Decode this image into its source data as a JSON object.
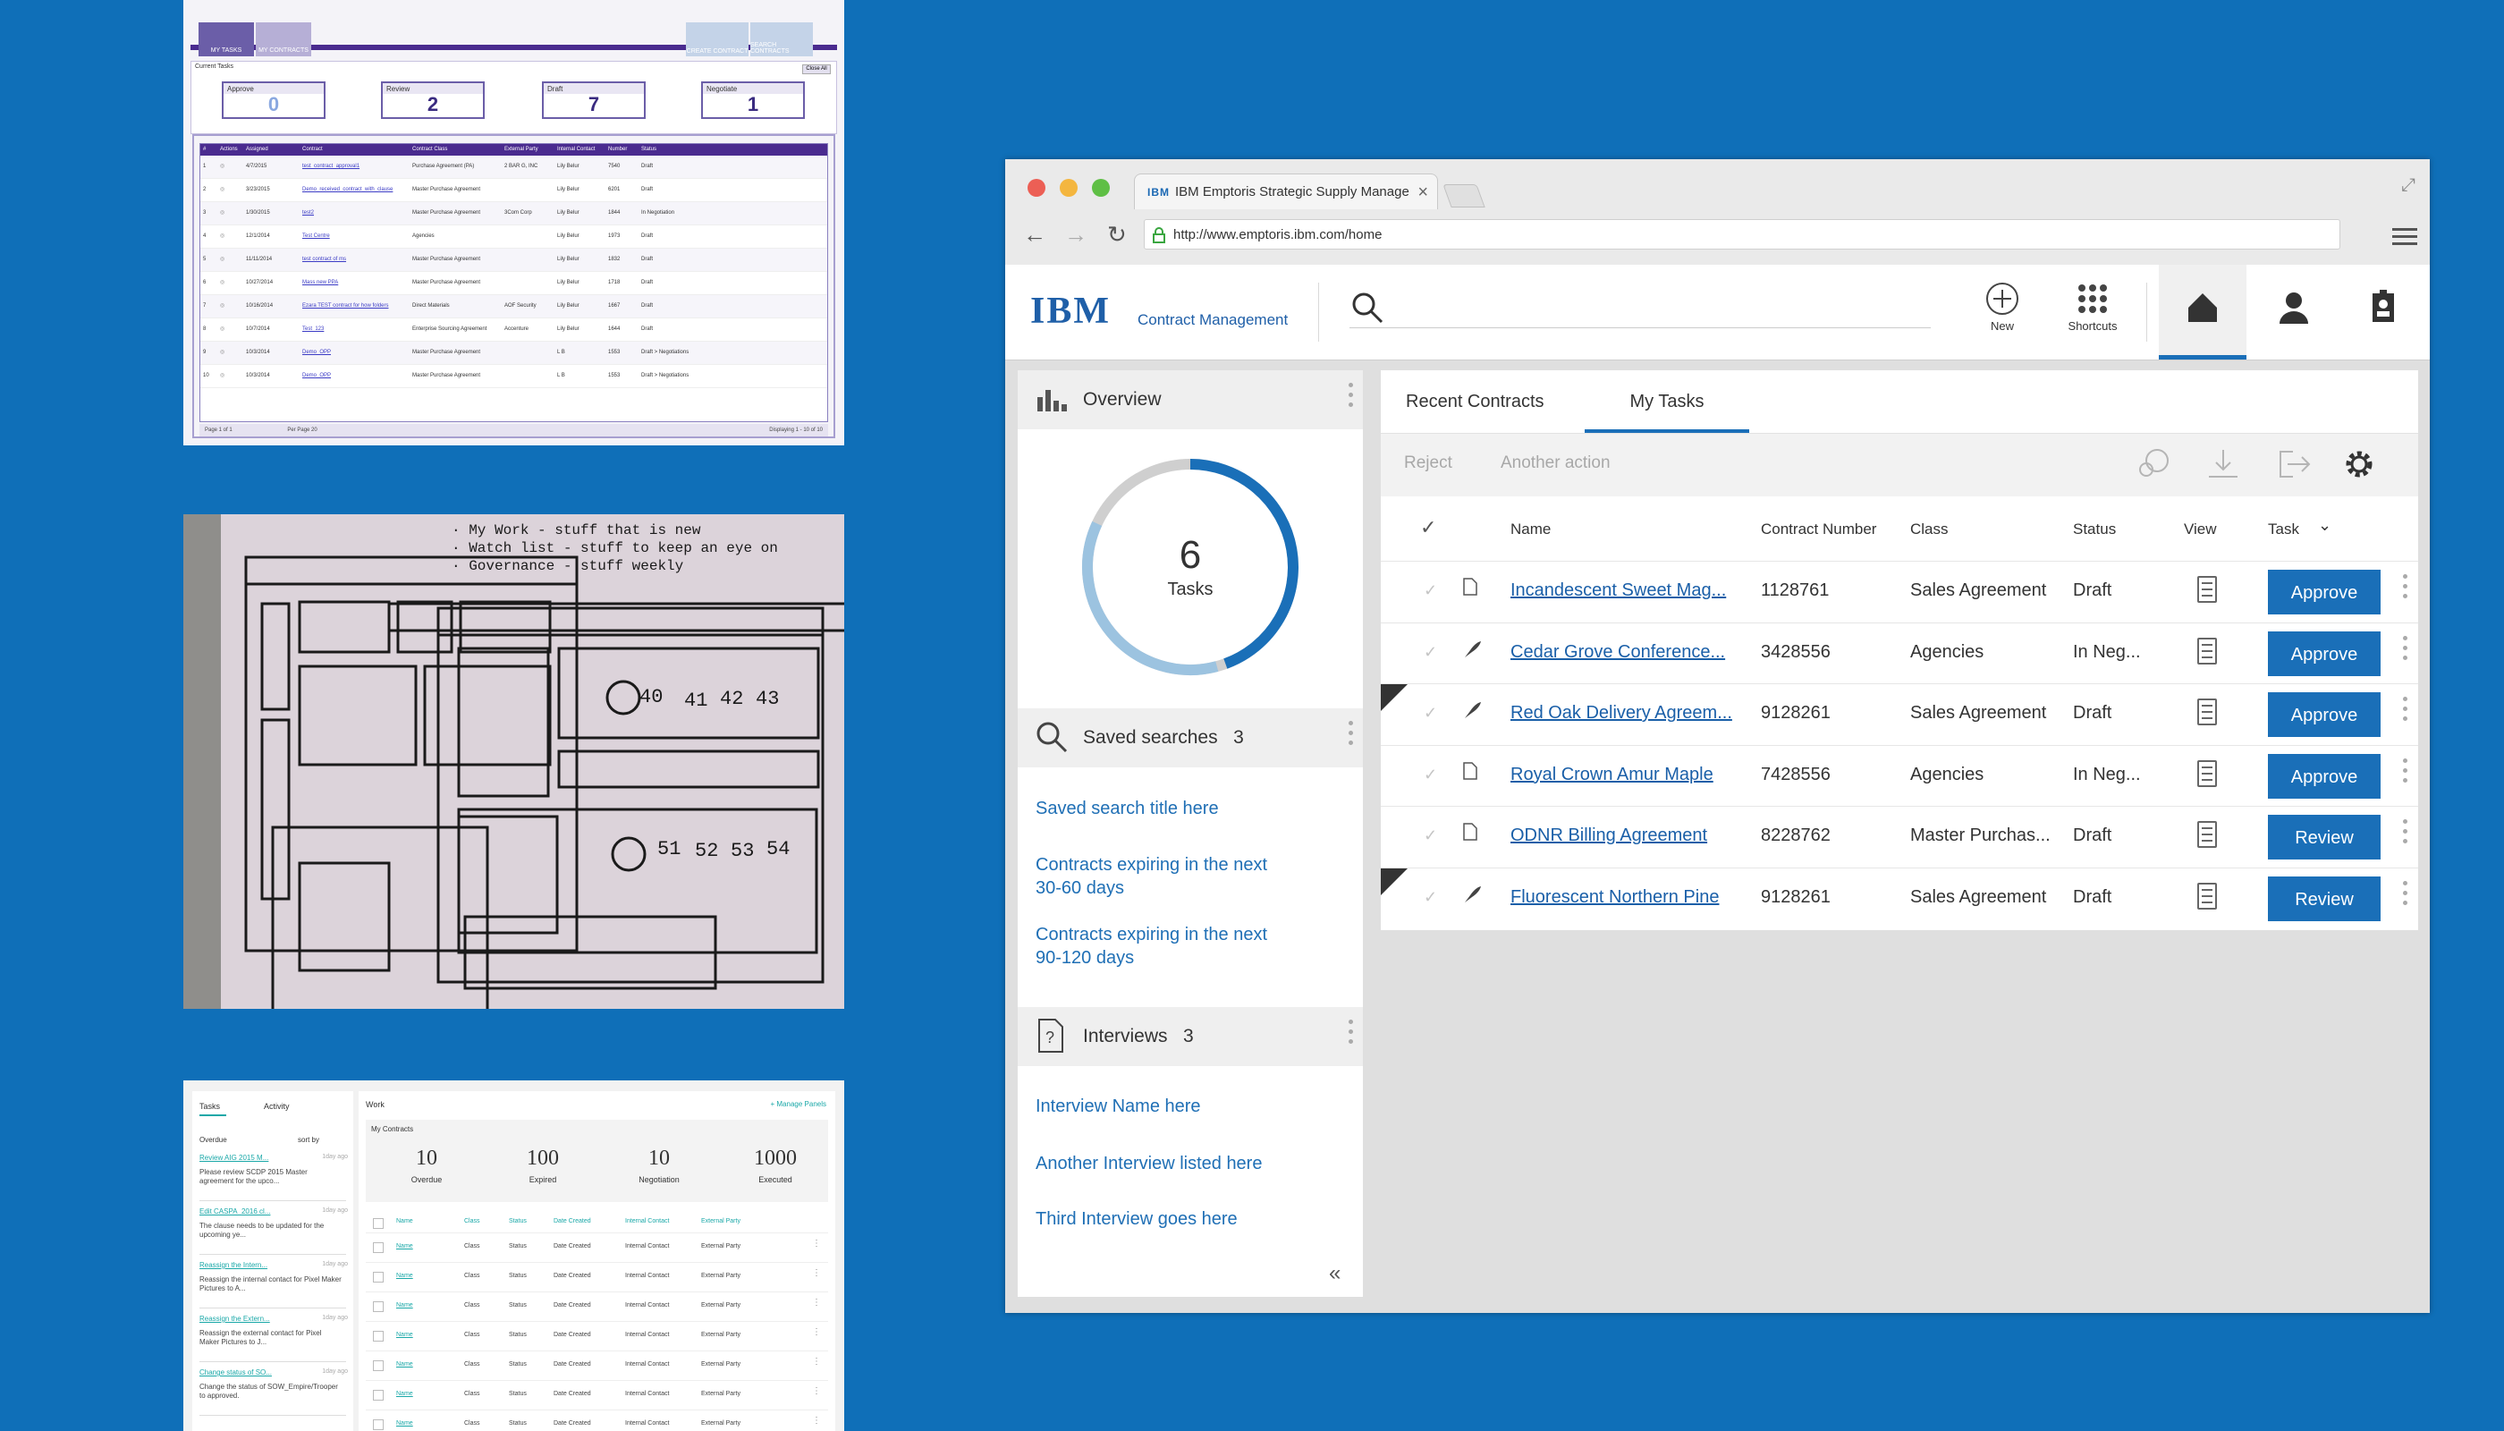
{
  "thumb_legacy": {
    "tabs": [
      "MY TASKS",
      "MY CONTRACTS"
    ],
    "actions": [
      "CREATE CONTRACT",
      "SEARCH CONTRACTS"
    ],
    "current_tasks_label": "Current Tasks",
    "close_label": "Close All",
    "boxes": [
      {
        "label": "Approve",
        "value": "0"
      },
      {
        "label": "Review",
        "value": "2"
      },
      {
        "label": "Draft",
        "value": "7"
      },
      {
        "label": "Negotiate",
        "value": "1"
      }
    ],
    "table_headers": [
      "#",
      "Actions",
      "Assigned",
      "Contract",
      "Contract Class",
      "External Party",
      "Internal Contact",
      "Number",
      "Status"
    ],
    "rows": [
      [
        "1",
        "4/7/2015",
        "test_contract_approval1",
        "Purchase Agreement (PA)",
        "2 BAR G, INC",
        "Lily Belur",
        "7540",
        "Draft"
      ],
      [
        "2",
        "3/23/2015",
        "Demo_received_contract_with_clause",
        "Master Purchase Agreement",
        "",
        "Lily Belur",
        "6201",
        "Draft"
      ],
      [
        "3",
        "1/30/2015",
        "test2",
        "Master Purchase Agreement",
        "3Com Corp",
        "Lily Belur",
        "1844",
        "In Negotiation"
      ],
      [
        "4",
        "12/1/2014",
        "Test Centre",
        "Agencies",
        "",
        "Lily Belur",
        "1973",
        "Draft"
      ],
      [
        "5",
        "11/11/2014",
        "test contract of ms",
        "Master Purchase Agreement",
        "",
        "Lily Belur",
        "1832",
        "Draft"
      ],
      [
        "6",
        "10/27/2014",
        "Mass new PPA",
        "Master Purchase Agreement",
        "",
        "Lily Belur",
        "1718",
        "Draft"
      ],
      [
        "7",
        "10/16/2014",
        "Ezara TEST contract for how folders",
        "Direct Materials",
        "AOF Security",
        "Lily Belur",
        "1667",
        "Draft"
      ],
      [
        "8",
        "10/7/2014",
        "Test_123",
        "Enterprise Sourcing Agreement",
        "Accenture",
        "Lily Belur",
        "1644",
        "Draft"
      ],
      [
        "9",
        "10/3/2014",
        "Demo_OPP",
        "Master Purchase Agreement",
        "",
        "L B",
        "1553",
        "Draft > Negotiations"
      ],
      [
        "10",
        "10/3/2014",
        "Demo_OPP",
        "Master Purchase Agreement",
        "",
        "L B",
        "1553",
        "Draft > Negotiations"
      ]
    ],
    "footer_left": "Page 1 of 1",
    "footer_per_page": "Per Page 20",
    "footer_right": "Displaying 1 - 10 of 10"
  },
  "thumb_panels": {
    "tabs": [
      "Tasks",
      "Activity"
    ],
    "overdue_label": "Overdue",
    "sort_label": "sort by",
    "tasks": [
      {
        "link": "Review AIG 2015 M...",
        "text": "Please review SCDP 2015 Master agreement for the upco...",
        "age": "1day ago"
      },
      {
        "link": "Edit CASPA_2016 cl...",
        "text": "The clause needs to be updated for the upcoming ye...",
        "age": "1day ago"
      },
      {
        "link": "Reassign the Intern...",
        "text": "Reassign the internal contact for Pixel Maker Pictures to A...",
        "age": "1day ago"
      },
      {
        "link": "Reassign the Extern...",
        "text": "Reassign the external contact for Pixel Maker Pictures to J...",
        "age": "1day ago"
      },
      {
        "link": "Change status of SO...",
        "text": "Change the status of SOW_Empire/Trooper to approved.",
        "age": "1day ago"
      }
    ],
    "work_label": "Work",
    "manage_label": "+ Manage Panels",
    "my_contracts_label": "My Contracts",
    "stats": [
      {
        "value": "10",
        "label": "Overdue"
      },
      {
        "value": "100",
        "label": "Expired"
      },
      {
        "value": "10",
        "label": "Negotiation"
      },
      {
        "value": "1000",
        "label": "Executed"
      }
    ],
    "headers": [
      "Name",
      "Class",
      "Status",
      "Date Created",
      "Internal Contact",
      "External Party"
    ],
    "row_cells": [
      "Name",
      "Class",
      "Status",
      "Date Created",
      "Internal Contact",
      "External Party"
    ]
  },
  "browser": {
    "tab_logo": "IBM",
    "tab_title": "IBM Emptoris Strategic Supply Manage",
    "url": "http://www.emptoris.ibm.com/home"
  },
  "app": {
    "logo": "IBM",
    "name": "Contract Management",
    "new_label": "New",
    "shortcuts_label": "Shortcuts"
  },
  "overview": {
    "title": "Overview",
    "count": "6",
    "count_label": "Tasks"
  },
  "saved_searches": {
    "title": "Saved searches",
    "count": "3",
    "items": [
      "Saved search title here",
      "Contracts expiring in the next",
      "30-60 days",
      "Contracts expiring in the next",
      "90-120 days"
    ]
  },
  "interviews": {
    "title": "Interviews",
    "count": "3",
    "items": [
      "Interview Name here",
      "Another Interview listed here",
      "Third Interview goes here"
    ]
  },
  "tabs": {
    "recent": "Recent Contracts",
    "my_tasks": "My Tasks"
  },
  "actions": {
    "reject": "Reject",
    "another": "Another action"
  },
  "columns": {
    "name": "Name",
    "number": "Contract Number",
    "class": "Class",
    "status": "Status",
    "view": "View",
    "task": "Task"
  },
  "tasks": [
    {
      "name": "Incandescent Sweet Mag...",
      "number": "1128761",
      "class": "Sales Agreement",
      "status": "Draft",
      "action": "Approve"
    },
    {
      "name": "Cedar Grove Conference...",
      "number": "3428556",
      "class": "Agencies",
      "status": "In Neg...",
      "action": "Approve"
    },
    {
      "name": "Red Oak Delivery Agreem...",
      "number": "9128261",
      "class": "Sales Agreement",
      "status": "Draft",
      "action": "Approve"
    },
    {
      "name": "Royal Crown Amur Maple",
      "number": "7428556",
      "class": "Agencies",
      "status": "In Neg...",
      "action": "Approve"
    },
    {
      "name": "ODNR Billing Agreement",
      "number": "8228762",
      "class": "Master Purchas...",
      "status": "Draft",
      "action": "Review"
    },
    {
      "name": "Fluorescent Northern Pine",
      "number": "9128261",
      "class": "Sales Agreement",
      "status": "Draft",
      "action": "Review"
    }
  ],
  "colors": {
    "background": "#0f6fb8",
    "accent": "#1a6fb8",
    "ring_light": "#9cc3e0",
    "ring_gray": "#cfcfcf"
  }
}
